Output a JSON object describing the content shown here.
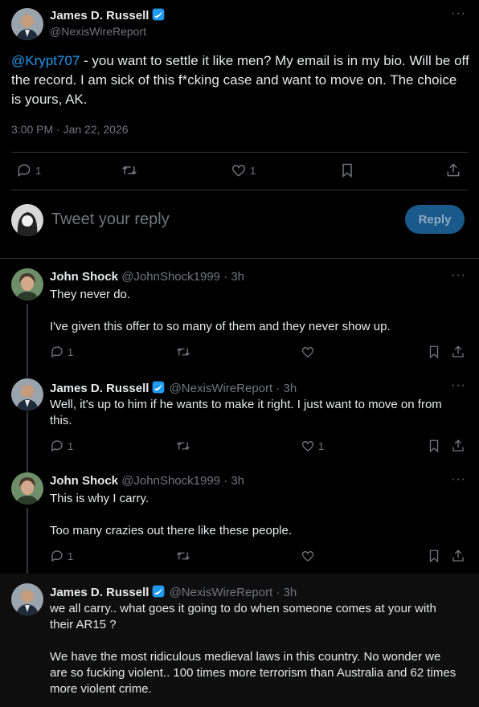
{
  "main_tweet": {
    "author_name": "James D. Russell",
    "author_handle": "@NexisWireReport",
    "mention": "@Krypt707",
    "text": " - you want to settle it like men? My email is in my bio. Will be off the record. I am sick of this f*cking case and want to move on. The choice is yours, AK.",
    "timestamp": "3:00 PM · Jan 22, 2026",
    "reply_count": "1",
    "like_count": "1"
  },
  "composer": {
    "placeholder": "Tweet your reply",
    "button_label": "Reply"
  },
  "replies": [
    {
      "name": "John Shock",
      "handle_time": "@JohnShock1999 · 3h",
      "text": "They never do.\n\nI've given this offer to so many of them and they never show up.",
      "reply_count": "1",
      "like_count": ""
    },
    {
      "name": "James D. Russell",
      "handle_time": "@NexisWireReport · 3h",
      "text": "Well, it's up to him if he wants to make it right. I just want to move on from this.",
      "reply_count": "1",
      "like_count": "1"
    },
    {
      "name": "John Shock",
      "handle_time": "@JohnShock1999 · 3h",
      "text": "This is why I carry.\n\nToo many crazies out there like these people.",
      "reply_count": "1",
      "like_count": ""
    },
    {
      "name": "James D. Russell",
      "handle_time": "@NexisWireReport · 3h",
      "text": "we all carry.. what goes it going to do when someone comes at your with their AR15 ?\n\nWe have the most ridiculous medieval laws in this country. No wonder we are so fucking violent..  100 times more terrorism than Australia and 62 times more violent crime."
    }
  ],
  "more_label": "···",
  "colors": {
    "accent": "#1d9bf0",
    "reply_button_bg": "#1a5a8a",
    "muted": "#71767b",
    "border": "#2f3336",
    "highlight_bg": "#0e0e0e"
  },
  "icons": [
    "verified-badge-icon",
    "more-icon",
    "reply-icon",
    "retweet-icon",
    "like-icon",
    "bookmark-icon",
    "share-icon"
  ]
}
